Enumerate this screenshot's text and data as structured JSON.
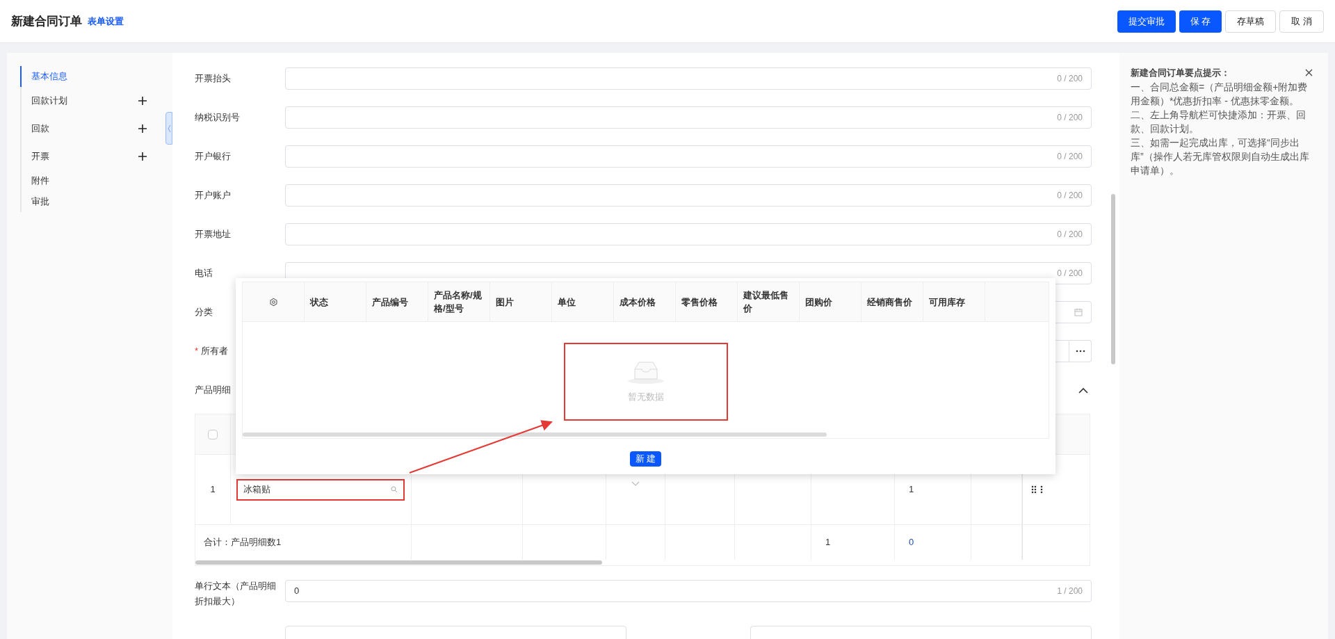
{
  "header": {
    "title": "新建合同订单",
    "settings_link": "表单设置",
    "buttons": [
      {
        "label": "提交审批",
        "kind": "primary"
      },
      {
        "label": "保 存",
        "kind": "primary"
      },
      {
        "label": "存草稿",
        "kind": "default"
      },
      {
        "label": "取 消",
        "kind": "default"
      }
    ]
  },
  "sidebar": {
    "items": [
      {
        "label": "基本信息",
        "selected": true,
        "addable": false
      },
      {
        "label": "回款计划",
        "selected": false,
        "addable": true
      },
      {
        "label": "回款",
        "selected": false,
        "addable": true
      },
      {
        "label": "开票",
        "selected": false,
        "addable": true
      },
      {
        "label": "附件",
        "selected": false,
        "addable": false
      },
      {
        "label": "审批",
        "selected": false,
        "addable": false
      }
    ]
  },
  "form": {
    "fields": [
      {
        "label": "开票抬头",
        "kind": "text",
        "counter": "0 / 200"
      },
      {
        "label": "纳税识别号",
        "kind": "text",
        "counter": "0 / 200"
      },
      {
        "label": "开户银行",
        "kind": "text",
        "counter": "0 / 200"
      },
      {
        "label": "开户账户",
        "kind": "text",
        "counter": "0 / 200"
      },
      {
        "label": "开票地址",
        "kind": "text",
        "counter": "0 / 200"
      },
      {
        "label": "电话",
        "kind": "text",
        "counter": "0 / 200"
      },
      {
        "label": "分类",
        "kind": "date"
      },
      {
        "label": "所有者",
        "kind": "picker",
        "required_mark": "*"
      }
    ]
  },
  "product_section": {
    "title": "产品明细",
    "expanded": true,
    "select_all_checked": false,
    "rows": [
      {
        "index": "1",
        "product": "冰箱贴",
        "cells": [
          {
            "kind": "empty"
          },
          {
            "kind": "empty"
          },
          {
            "kind": "select"
          },
          {
            "kind": "empty"
          },
          {
            "kind": "empty"
          },
          {
            "kind": "empty"
          },
          {
            "kind": "text",
            "text": "1"
          },
          {
            "kind": "empty"
          }
        ]
      }
    ],
    "total": {
      "label": "合计：产品明细数1",
      "cells": [
        {
          "kind": "empty"
        },
        {
          "kind": "empty"
        },
        {
          "kind": "empty"
        },
        {
          "kind": "empty"
        },
        {
          "kind": "empty"
        },
        {
          "kind": "text",
          "text": "1"
        },
        {
          "kind": "link",
          "text": "0"
        }
      ]
    }
  },
  "extra_field": {
    "label": "单行文本（产品明细折扣最大）",
    "value": "0",
    "counter": "1 / 200"
  },
  "hint": {
    "title": "新建合同订单要点提示：",
    "lines": [
      "一、合同总金额=（产品明细金额+附加费用金额）*优惠折扣率 - 优惠抹零金额。",
      "二、左上角导航栏可快捷添加：开票、回款、回款计划。",
      "三、如需一起完成出库，可选择“同步出库”（操作人若无库管权限则自动生成出库申请单）。"
    ]
  },
  "popup": {
    "columns": [
      "状态",
      "产品编号",
      "产品名称/规格/型号",
      "图片",
      "单位",
      "成本价格",
      "零售价格",
      "建议最低售价",
      "团购价",
      "经销商售价",
      "可用库存"
    ],
    "empty_text": "暂无数据",
    "new_button": "新 建"
  }
}
